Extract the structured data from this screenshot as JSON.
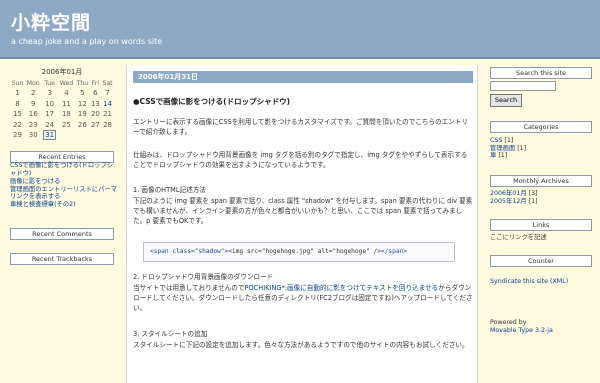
{
  "header": {
    "title": "小粋空間",
    "subtitle": "a cheap joke and a play on words site"
  },
  "calendar": {
    "caption": "2006年01月",
    "weekdays": [
      "Sun",
      "Mon",
      "Tue",
      "Wed",
      "Thu",
      "Fri",
      "Sat"
    ],
    "weeks": [
      [
        "1",
        "2",
        "3",
        "4",
        "5",
        "6",
        "7"
      ],
      [
        "8",
        "9",
        "10",
        "11",
        "12",
        "13",
        "14"
      ],
      [
        "15",
        "16",
        "17",
        "18",
        "19",
        "20",
        "21"
      ],
      [
        "22",
        "23",
        "24",
        "25",
        "26",
        "27",
        "28"
      ],
      [
        "29",
        "30",
        "31",
        "",
        "",
        "",
        ""
      ]
    ],
    "linked_days": [
      "14",
      "31"
    ],
    "today": "31"
  },
  "left_sidebar": {
    "recent_entries_title": "Recent Entries",
    "recent_entries": [
      "CSSで画像に影をつける(ドロップシャドウ)",
      "画像に影をつける",
      "管理画面のエントリーリストにパーマリンクを表示する",
      "車検と検査標章(その2)"
    ],
    "recent_comments_title": "Recent Comments",
    "recent_trackbacks_title": "Recent Trackbacks"
  },
  "main": {
    "date": "2006年01月31日",
    "post_title": "●CSSで画像に影をつける(ドロップシャドウ)",
    "intro": "エントリーに表示する画像にCSSを利用して影をつけるカスタマイズです。ご質問を頂いたのでこちらのエントリーで紹介致します。",
    "mechanism": "仕組みは、ドロップシャドウ用背景画像を img タグを括る別のタグで指定し、img タグをややずらして表示することでドロップシャドウの効果を出すようになっているようです。",
    "step1_heading": "1. 画像のHTML記述方法",
    "step1_body": "下記のように img 要素を span 要素で括り、class 属性 \"shadow\" を付与します。span 要素の代わりに div 要素でも構いませんが、インライン要素の方が色々と都合がいいかも？と思い、ここでは span 要素で括ってみました。p 要素でもOKです。",
    "code_open": "<span class=\"shadow\">",
    "code_middle": "<img src=\"hogehoge.jpg\" alt=\"hogehoge\" />",
    "code_close": "</span>",
    "step2_heading": "2. ドロップシャドウ用背景画像のダウンロード",
    "step2_pre": "当サイトでは用意しておりませんので",
    "step2_link": "POCHIKING*:画像に自動的に影をつけてテキストを回り込ませる",
    "step2_post": "からダウンロードしてください。ダウンロードしたら任意のディレクトリ(FC2ブログは固定ですね)へアップロードしてください。",
    "step3_heading": "3. スタイルシートの追加",
    "step3_body": "スタイルシートに下記の設定を追加します。色々な方法があるようですので他のサイトの内容もお試しください。"
  },
  "right_sidebar": {
    "search_title": "Search this site",
    "search_value": "",
    "search_button": "Search",
    "categories_title": "Categories",
    "categories": [
      {
        "name": "CSS",
        "count": "[1]"
      },
      {
        "name": "管理画面",
        "count": "[1]"
      },
      {
        "name": "車",
        "count": "[1]"
      }
    ],
    "archives_title": "Monthly Archives",
    "archives": [
      {
        "name": "2006年01月",
        "count": "[3]"
      },
      {
        "name": "2005年12月",
        "count": "[1]"
      }
    ],
    "links_title": "Links",
    "links_text": "ここにリンクを記述",
    "counter_title": "Counter",
    "syndicate": "Syndicate this site (XML)",
    "powered_by": "Powered by",
    "powered_link": "Movable Type 3.2-ja"
  }
}
